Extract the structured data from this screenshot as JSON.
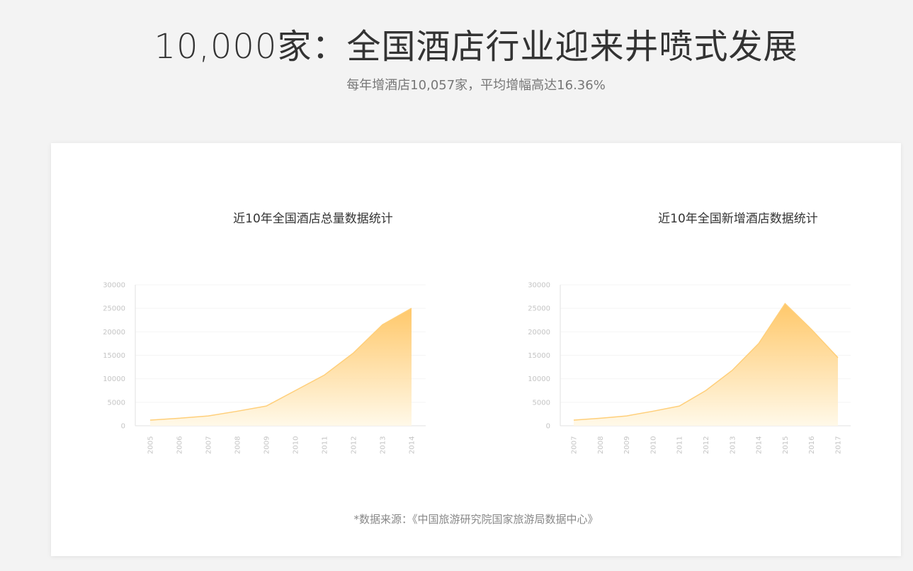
{
  "header": {
    "title": "10,000家：全国酒店行业迎来井喷式发展",
    "subtitle": "每年增酒店10,057家，平均增幅高达16.36%"
  },
  "footer": {
    "source": "*数据来源：《中国旅游研究院国家旅游局数据中心》"
  },
  "colors": {
    "area_top": "#ffc25a",
    "area_bottom": "#fff8e6",
    "gridline": "#f4f4f4",
    "axis": "#e2e2e2"
  },
  "chart_data": [
    {
      "type": "area",
      "title": "近10年全国酒店总量数据统计",
      "x": [
        "2005",
        "2006",
        "2007",
        "2008",
        "2009",
        "2010",
        "2011",
        "2012",
        "2013",
        "2014"
      ],
      "series": [
        {
          "values": [
            1200,
            1600,
            2100,
            3100,
            4200,
            7500,
            10800,
            15500,
            21500,
            25000
          ]
        }
      ],
      "ylim": [
        0,
        30000
      ],
      "yticks": [
        "0",
        "5000",
        "10000",
        "15000",
        "20000",
        "25000",
        "30000"
      ],
      "xlabel": "",
      "ylabel": "",
      "grid": true
    },
    {
      "type": "area",
      "title": "近10年全国新增酒店数据统计",
      "x": [
        "2007",
        "2008",
        "2009",
        "2010",
        "2011",
        "2012",
        "2013",
        "2014",
        "2015",
        "2016",
        "2017"
      ],
      "series": [
        {
          "values": [
            1200,
            1600,
            2100,
            3100,
            4200,
            7500,
            11800,
            17500,
            26000,
            20500,
            14500
          ]
        }
      ],
      "ylim": [
        0,
        30000
      ],
      "yticks": [
        "0",
        "5000",
        "10000",
        "15000",
        "20000",
        "25000",
        "30000"
      ],
      "xlabel": "",
      "ylabel": "",
      "grid": true
    }
  ]
}
